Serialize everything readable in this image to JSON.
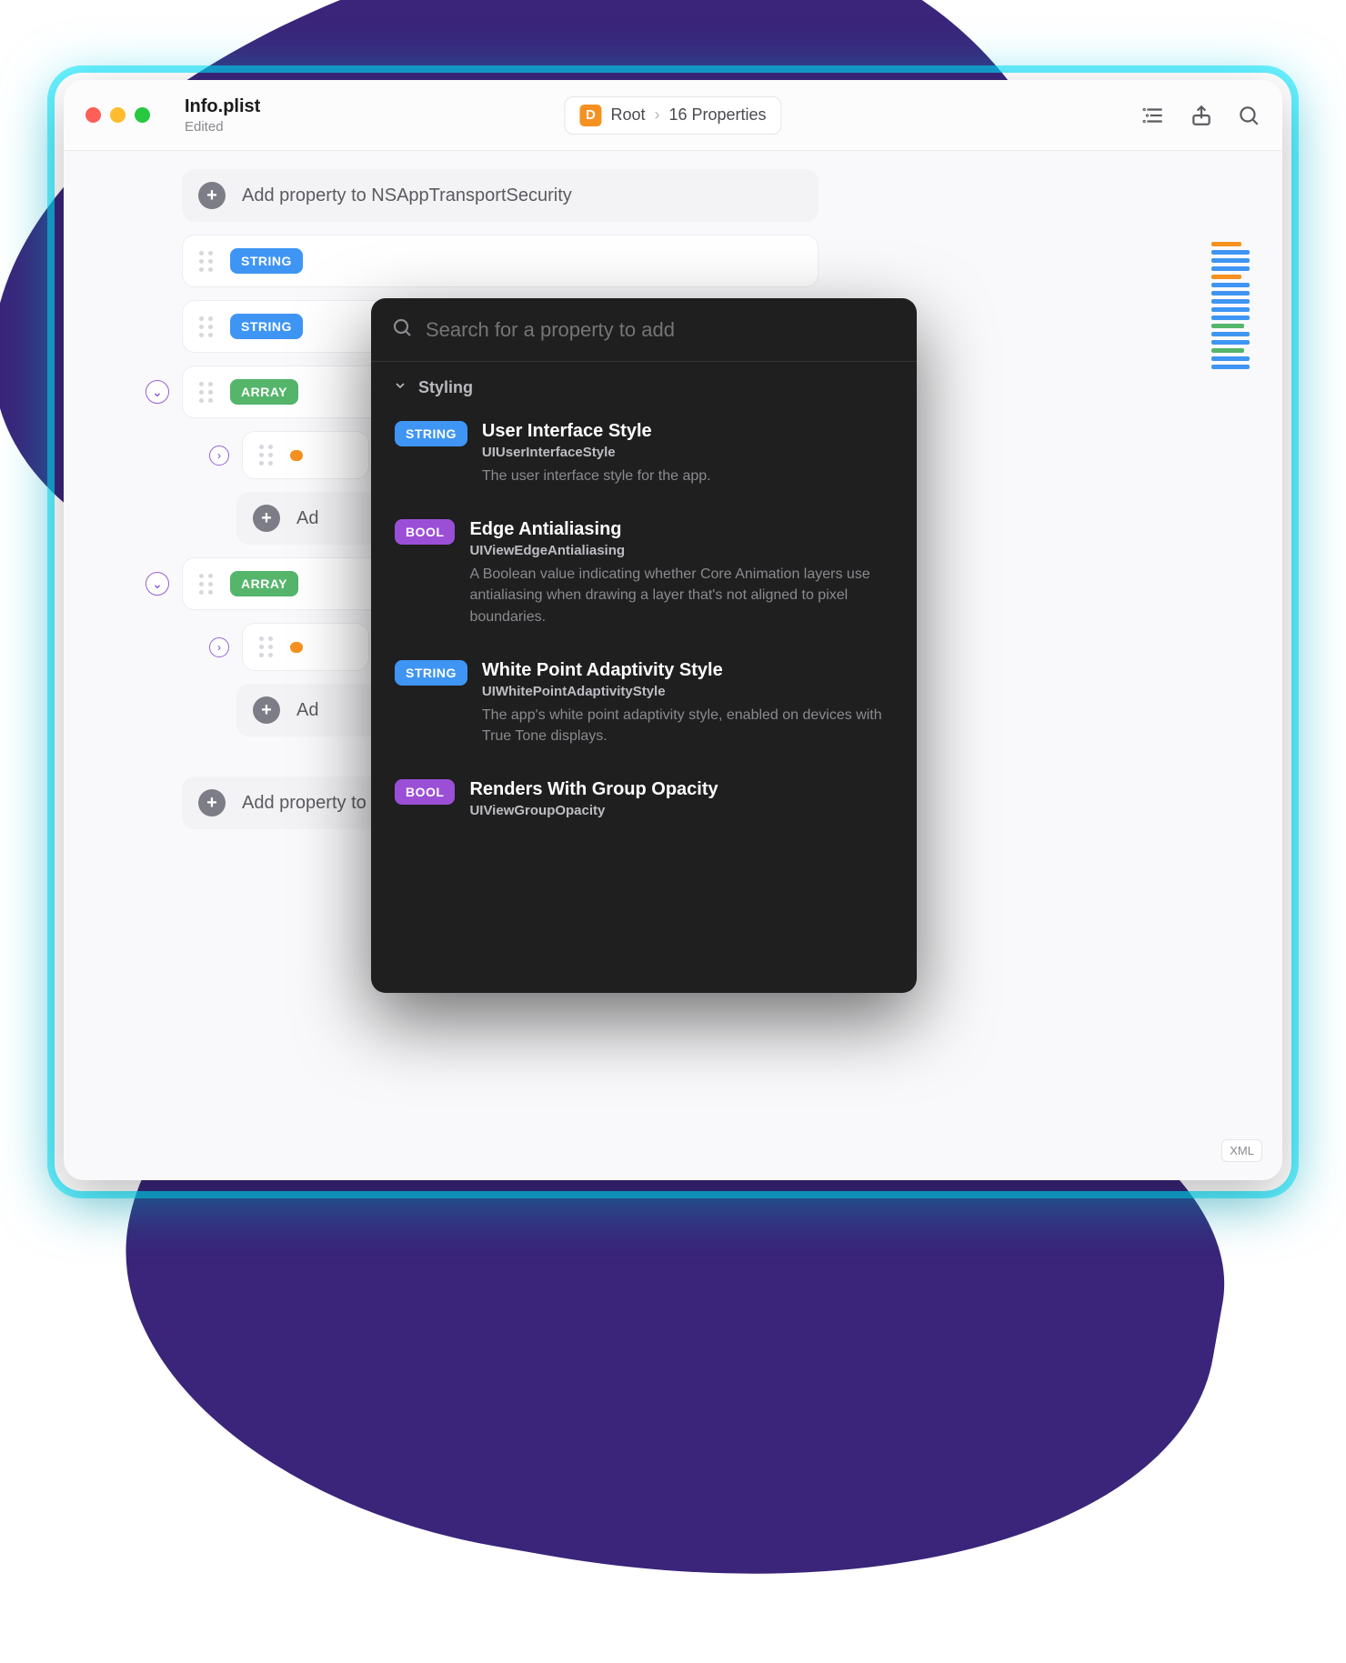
{
  "window": {
    "title": "Info.plist",
    "subtitle": "Edited"
  },
  "breadcrumb": {
    "badge_letter": "D",
    "root": "Root",
    "count": "16 Properties"
  },
  "rows": {
    "add_nsats": "Add property to NSAppTransportSecurity",
    "string_label": "STRING",
    "array_label": "ARRAY",
    "add_generic": "Ad",
    "add_root": "Add property to Root"
  },
  "xml_badge": "XML",
  "popup": {
    "search_placeholder": "Search for a property to add",
    "section": "Styling",
    "items": [
      {
        "type": "STRING",
        "type_class": "string",
        "title": "User Interface Style",
        "key": "UIUserInterfaceStyle",
        "desc": "The user interface style for the app."
      },
      {
        "type": "BOOL",
        "type_class": "bool",
        "title": "Edge Antialiasing",
        "key": "UIViewEdgeAntialiasing",
        "desc": "A Boolean value indicating whether Core Animation layers use antialiasing when drawing a layer that's not aligned to pixel boundaries."
      },
      {
        "type": "STRING",
        "type_class": "string",
        "title": "White Point Adaptivity Style",
        "key": "UIWhitePointAdaptivityStyle",
        "desc": "The app's white point adaptivity style, enabled on devices with True Tone displays."
      },
      {
        "type": "BOOL",
        "type_class": "bool",
        "title": "Renders With Group Opacity",
        "key": "UIViewGroupOpacity",
        "desc": ""
      }
    ]
  }
}
